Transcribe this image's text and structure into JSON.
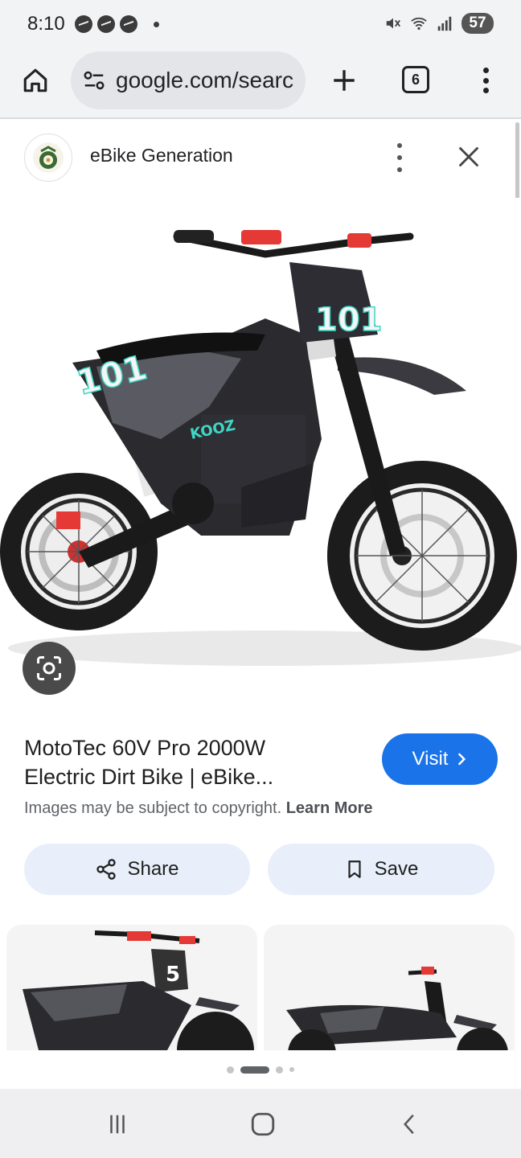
{
  "status_bar": {
    "time": "8:10",
    "battery": "57",
    "icons": [
      "messenger-icon",
      "messenger-icon",
      "messenger-icon",
      "dot-icon",
      "mute-icon",
      "wifi-icon",
      "signal-icon"
    ]
  },
  "browser": {
    "url": "google.com/searc",
    "tab_count": "6"
  },
  "source": {
    "name": "eBike Generation"
  },
  "result": {
    "title_line1": "MotoTec 60V Pro 2000W",
    "title_line2": "Electric Dirt Bike | eBike...",
    "visit_label": "Visit",
    "copyright_text": "Images may be subject to copyright.",
    "learn_more": "Learn More",
    "share_label": "Share",
    "save_label": "Save"
  },
  "image": {
    "front_plate": "101",
    "side_plate": "101",
    "side_text": "KOOZ",
    "thumb1_plate": "5"
  },
  "colors": {
    "accent": "#1a73e8",
    "teal": "#3fd6c4",
    "red": "#e53935"
  }
}
